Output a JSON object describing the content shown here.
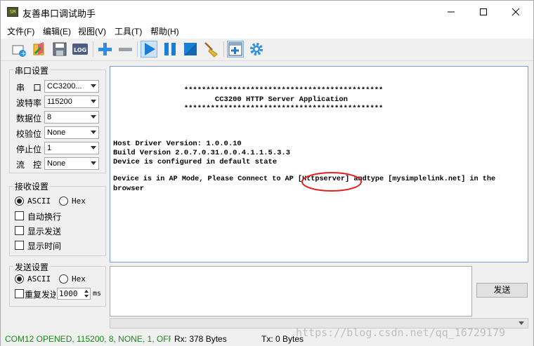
{
  "window": {
    "title": "友善串口调试助手",
    "app_icon_text": "SM"
  },
  "menu": [
    "文件(F)",
    "编辑(E)",
    "视图(V)",
    "工具(T)",
    "帮助(H)"
  ],
  "toolbar": {
    "log_label": "LOG",
    "icons": [
      "new-session-icon",
      "open-icon",
      "save-icon",
      "log-icon",
      "add-icon",
      "remove-icon",
      "play-icon",
      "pause-icon",
      "stop-icon",
      "clear-broom-icon",
      "add-window-icon",
      "settings-gear-icon"
    ]
  },
  "serial": {
    "group_title": "串口设置",
    "port_label": "串　口",
    "port_value": "CC3200...",
    "baud_label": "波特率",
    "baud_value": "115200",
    "data_label": "数据位",
    "data_value": "8",
    "parity_label": "校验位",
    "parity_value": "None",
    "stop_label": "停止位",
    "stop_value": "1",
    "flow_label": "流　控",
    "flow_value": "None"
  },
  "receive": {
    "group_title": "接收设置",
    "ascii": "ASCII",
    "hex": "Hex",
    "auto_wrap": "自动换行",
    "show_send": "显示发送",
    "show_time": "显示时间"
  },
  "send": {
    "group_title": "发送设置",
    "ascii": "ASCII",
    "hex": "Hex",
    "repeat": "重复发送",
    "interval": "1000",
    "unit": "ms",
    "button": "发送"
  },
  "output_lines": [
    "                *********************************************",
    "                       CC3200 HTTP Server Application",
    "                *********************************************",
    "",
    "",
    "Host Driver Version: 1.0.0.10",
    "Build Version 2.0.7.0.31.0.0.4.1.1.5.3.3",
    "Device is configured in default state",
    "",
    "Device is in AP Mode, Please Connect to AP [Httpserver] andtype [mysimplelink.net] in the",
    "browser"
  ],
  "status": {
    "port": "COM12 OPENED, 115200, 8, NONE, 1, OFF",
    "rx": "Rx: 378 Bytes",
    "tx": "Tx: 0 Bytes"
  },
  "watermark": "https://blog.csdn.net/qq_16729179",
  "colors": {
    "accent_blue": "#1a7fd4",
    "highlight_circle": "#e02020"
  }
}
